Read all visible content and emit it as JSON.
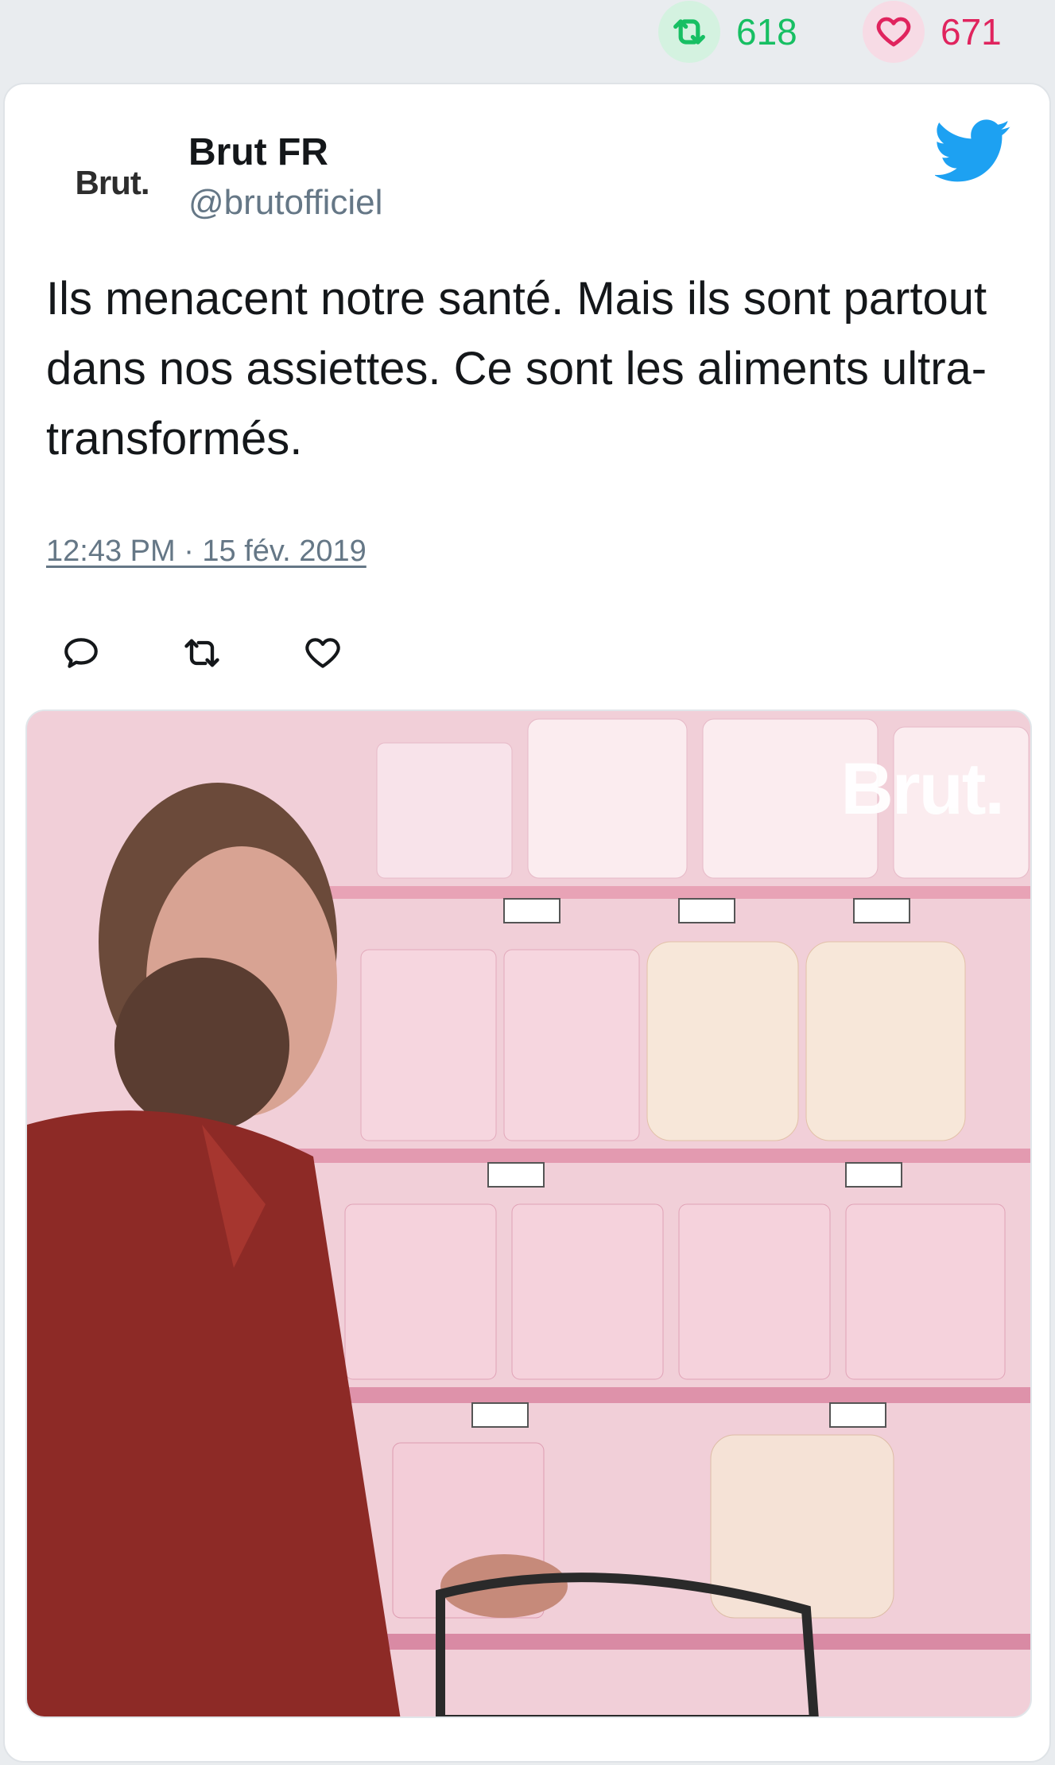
{
  "stats": {
    "retweets": "618",
    "likes": "671"
  },
  "author": {
    "logo_text": "Brut.",
    "name": "Brut FR",
    "handle": "@brutofficiel"
  },
  "tweet": {
    "text": "Ils menacent notre santé. Mais ils sont partout dans nos assiettes. Ce sont les aliments ultra-transformés.",
    "timestamp": "12:43 PM · 15 fév. 2019"
  },
  "media": {
    "watermark": "Brut."
  },
  "colors": {
    "retweet": "#17bf63",
    "like": "#e0245e",
    "twitter_blue": "#1da1f2",
    "muted": "#657786"
  },
  "icons": [
    "retweet-icon",
    "heart-icon",
    "twitter-bird-icon",
    "reply-icon"
  ]
}
